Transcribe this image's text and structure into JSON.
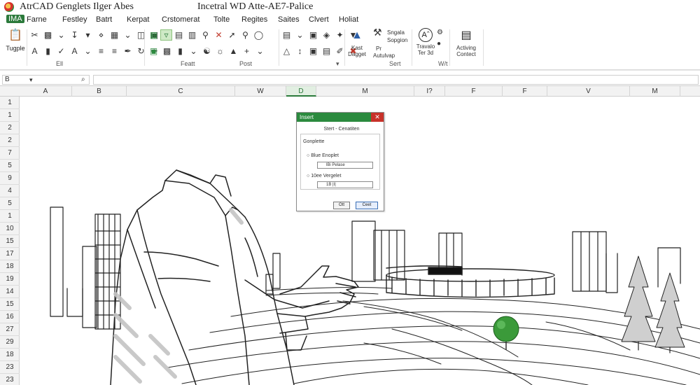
{
  "window": {
    "title_left": "AtrCAD Genglets Ilger Abes",
    "title_center": "Incetral WD Atte-AE7-Palice"
  },
  "menu": {
    "items": [
      "Farne",
      "Festley",
      "Batrt",
      "Kerpat",
      "Crstomerat",
      "Tolte",
      "Regites",
      "Saites",
      "Clvert",
      "Holiat"
    ]
  },
  "ribbon": {
    "left_button": "Tugple",
    "sections": [
      "Ell",
      "Featt",
      "Post",
      "Sert",
      "W/t"
    ],
    "dagget_lines": [
      "Kast",
      "Dagget"
    ],
    "autoso_lines": [
      "Sngala",
      "Sopgion",
      "Pr",
      "Autulvap"
    ],
    "trevalo_lines": [
      "Travalo",
      "Ter 3d"
    ],
    "activing_lines": [
      "Activing",
      "Contect"
    ]
  },
  "formula_bar": {
    "name_box": "B",
    "name_arrow": "▾",
    "fx": "⌕",
    "value": ""
  },
  "grid": {
    "columns": [
      "A",
      "B",
      "C",
      "W",
      "D",
      "M",
      "I?",
      "F",
      "F",
      "V",
      "M"
    ],
    "selected_column": "D",
    "rows": [
      "1",
      "1",
      "2",
      "2",
      "7",
      "5",
      "9",
      "4",
      "5",
      "1",
      "10",
      "15",
      "17",
      "18",
      "19",
      "14",
      "15",
      "16",
      "27",
      "29",
      "18",
      "23",
      "23"
    ]
  },
  "dialog": {
    "title": "Insert",
    "close": "✕",
    "group": "Stert - Cenatiten",
    "fieldset_label": "Gonplette",
    "option1_label": "Blue Enoplet",
    "option1_value": "lBi Pelase",
    "option2_label": "10ee Vergelet",
    "option2_value": "1B |I|",
    "ok": "Ott",
    "cancel": "Ceet"
  },
  "colors": {
    "accent": "#2b7a3b",
    "dialog_title": "#2b8a3e",
    "close": "#c8322a"
  }
}
